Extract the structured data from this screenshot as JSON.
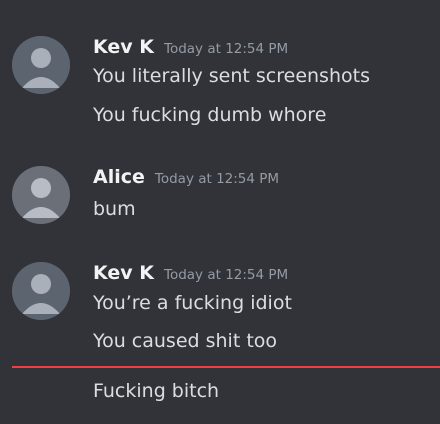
{
  "messages": [
    {
      "username": "Kev K",
      "timestamp": "Today at 12:54 PM",
      "lines": [
        "You literally sent screenshots",
        "You fucking dumb whore"
      ]
    },
    {
      "username": "Alice",
      "timestamp": "Today at 12:54 PM",
      "lines": [
        "bum"
      ]
    },
    {
      "username": "Kev K",
      "timestamp": "Today at 12:54 PM",
      "lines": [
        "You’re a fucking idiot",
        "You caused shit too"
      ]
    }
  ],
  "after_new_divider": [
    "Fucking bitch"
  ],
  "colors": {
    "background": "#313338",
    "username": "#f2f3f5",
    "message_text": "#dbdee1",
    "timestamp": "#949ba4",
    "new_messages_divider": "#f23f43"
  }
}
